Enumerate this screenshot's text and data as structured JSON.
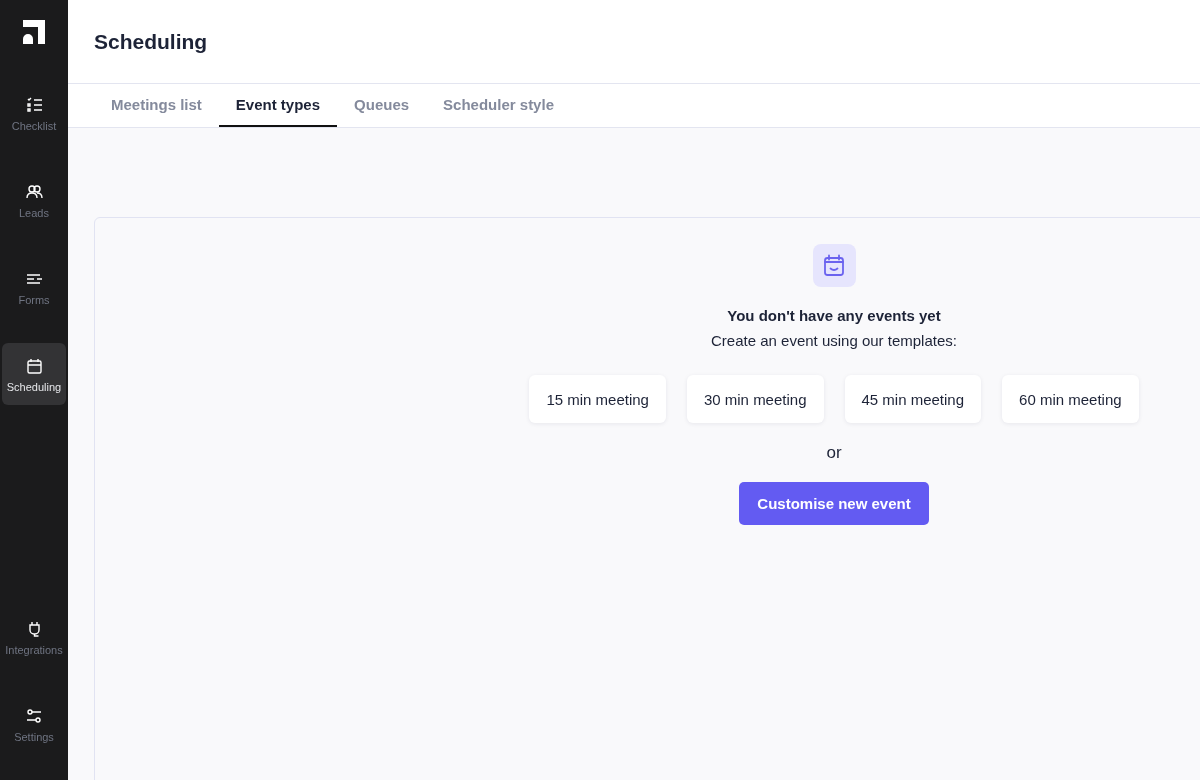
{
  "sidebar": {
    "items": [
      {
        "label": "Checklist",
        "selected": false
      },
      {
        "label": "Leads",
        "selected": false
      },
      {
        "label": "Forms",
        "selected": false
      },
      {
        "label": "Scheduling",
        "selected": true
      }
    ],
    "bottom_items": [
      {
        "label": "Integrations",
        "selected": false
      },
      {
        "label": "Settings",
        "selected": false
      }
    ]
  },
  "header": {
    "title": "Scheduling"
  },
  "tabs": [
    {
      "label": "Meetings list",
      "selected": false
    },
    {
      "label": "Event types",
      "selected": true
    },
    {
      "label": "Queues",
      "selected": false
    },
    {
      "label": "Scheduler style",
      "selected": false
    }
  ],
  "empty_state": {
    "title": "You don't have any events yet",
    "subtitle": "Create an event using our templates:",
    "templates": [
      "15 min meeting",
      "30 min meeting",
      "45 min meeting",
      "60 min meeting"
    ],
    "separator": "or",
    "primary_button": "Customise new event"
  }
}
